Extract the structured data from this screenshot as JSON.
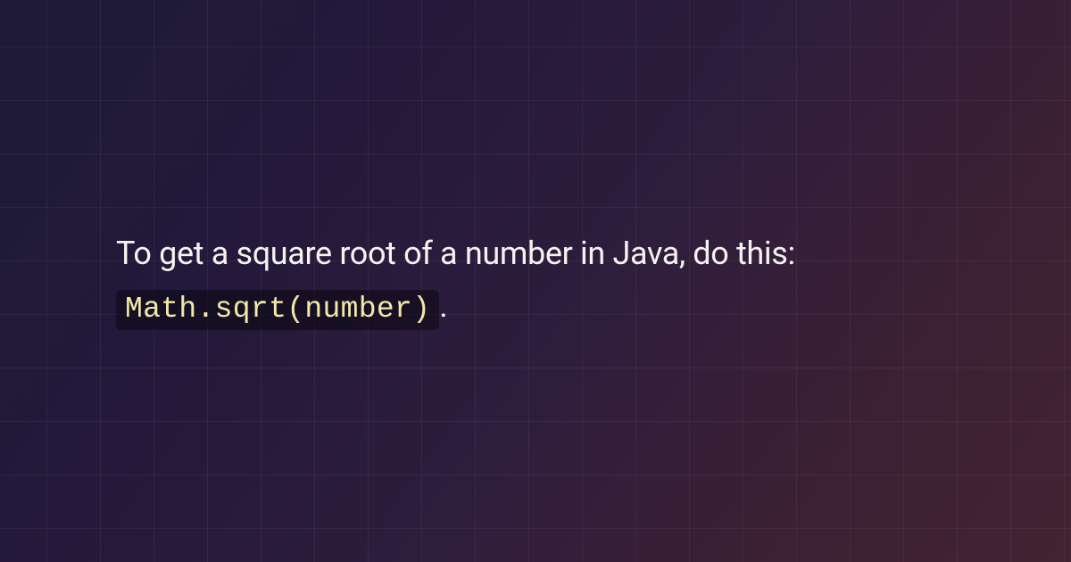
{
  "content": {
    "text_before": "To get a square root of a number in Java, do this: ",
    "code": "Math.sqrt(number)",
    "text_after": "."
  }
}
